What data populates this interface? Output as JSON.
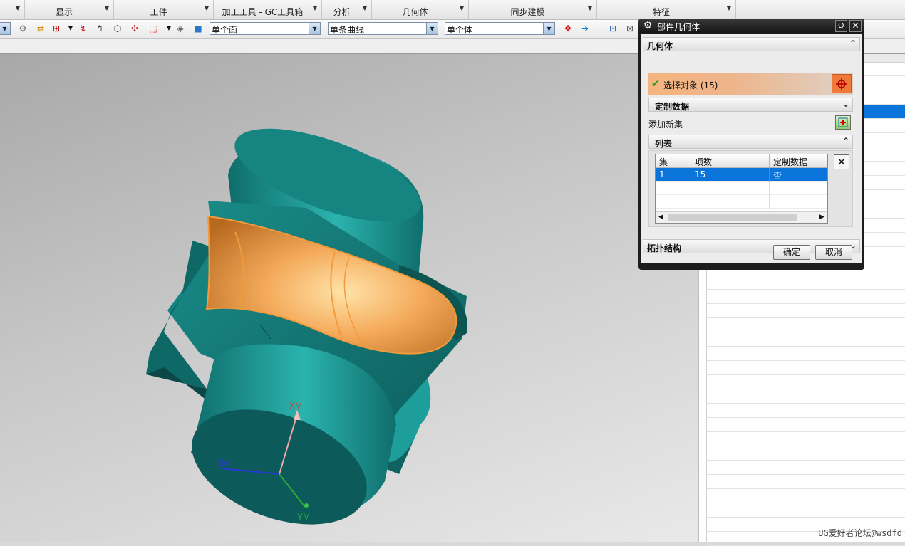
{
  "ribbon": {
    "groups": [
      {
        "label": ""
      },
      {
        "label": "显示"
      },
      {
        "label": "工件"
      },
      {
        "label": "加工工具 - GC工具箱"
      },
      {
        "label": "分析"
      },
      {
        "label": "几何体"
      },
      {
        "label": "同步建模"
      },
      {
        "label": "特征"
      }
    ]
  },
  "toolbar": {
    "filter_face": "单个面",
    "filter_curve": "单条曲线",
    "filter_body": "单个体",
    "icons": [
      "filter-icon",
      "snap-icon",
      "select-icon",
      "point-icon",
      "curve-icon",
      "hexagon-icon",
      "face-icon",
      "box-select-icon",
      "solid-icon",
      "cube-icon",
      "redo-icon",
      "arrow-right-icon",
      "zoom-icon",
      "view-icon"
    ]
  },
  "viewport": {
    "axes": {
      "x": "XM",
      "y": "YM",
      "z": "ZM"
    },
    "colors": {
      "body": "#1b8f8d",
      "selected_faces": "#f2a455"
    }
  },
  "dialog": {
    "title": "部件几何体",
    "section_geometry": "几何体",
    "select_object": "选择对象 (15)",
    "section_custom_data": "定制数据",
    "add_new_set": "添加新集",
    "section_list": "列表",
    "table": {
      "headers": [
        "集",
        "项数",
        "定制数据"
      ],
      "rows": [
        [
          "1",
          "15",
          "否"
        ]
      ]
    },
    "section_topology": "拓扑结构",
    "ok": "确定",
    "cancel": "取消"
  },
  "watermark": "UG爱好者论坛@wsdfd"
}
